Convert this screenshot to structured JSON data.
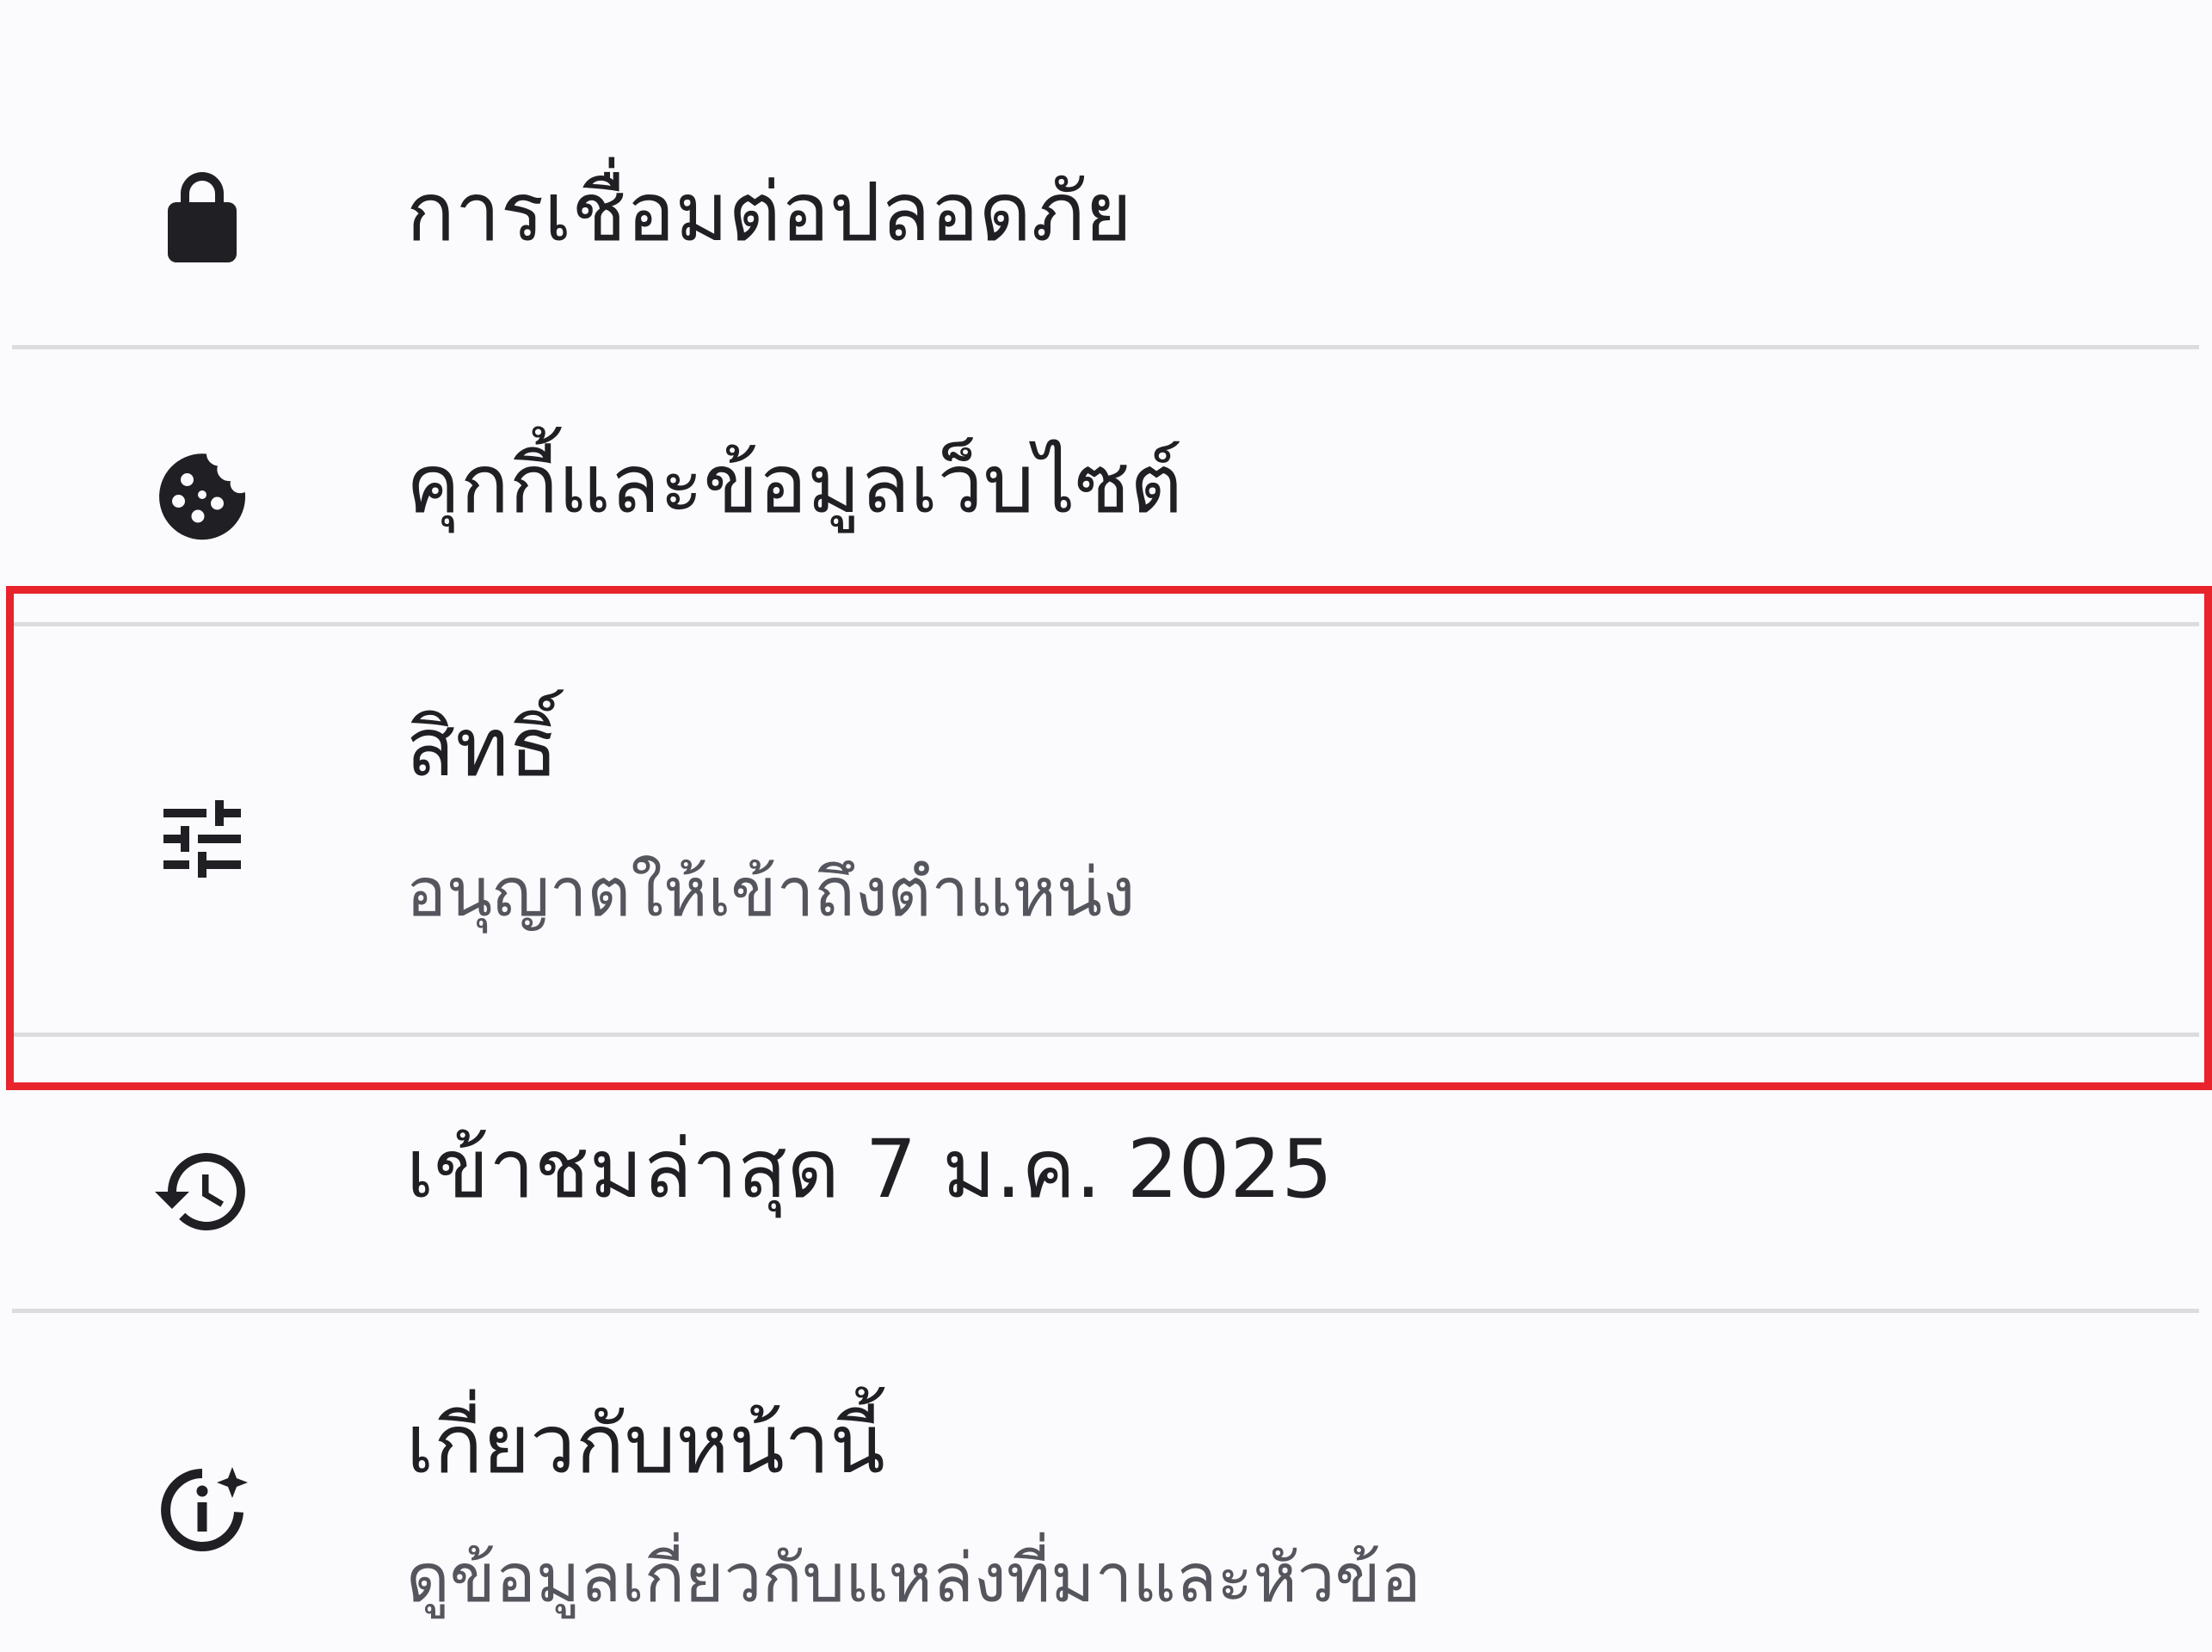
{
  "colors": {
    "background": "#fbfbfe",
    "text_primary": "#1f1f24",
    "text_secondary": "#55555d",
    "divider": "#dcdcdf",
    "highlight": "#e8232b"
  },
  "items": [
    {
      "icon": "lock-icon",
      "title": "การเชื่อมต่อปลอดภัย"
    },
    {
      "icon": "cookie-icon",
      "title": "คุกกี้และข้อมูลเว็บไซต์"
    },
    {
      "icon": "tune-sliders-icon",
      "title": "สิทธิ์",
      "subtitle": "อนุญาตให้เข้าถึงตำแหน่ง",
      "highlighted": true
    },
    {
      "icon": "history-icon",
      "title": "เข้าชมล่าสุด 7 ม.ค. 2025"
    },
    {
      "icon": "info-sparkle-icon",
      "title": "เกี่ยวกับหน้านี้",
      "subtitle": "ดูข้อมูลเกี่ยวกับแหล่งที่มาและหัวข้อ"
    }
  ]
}
